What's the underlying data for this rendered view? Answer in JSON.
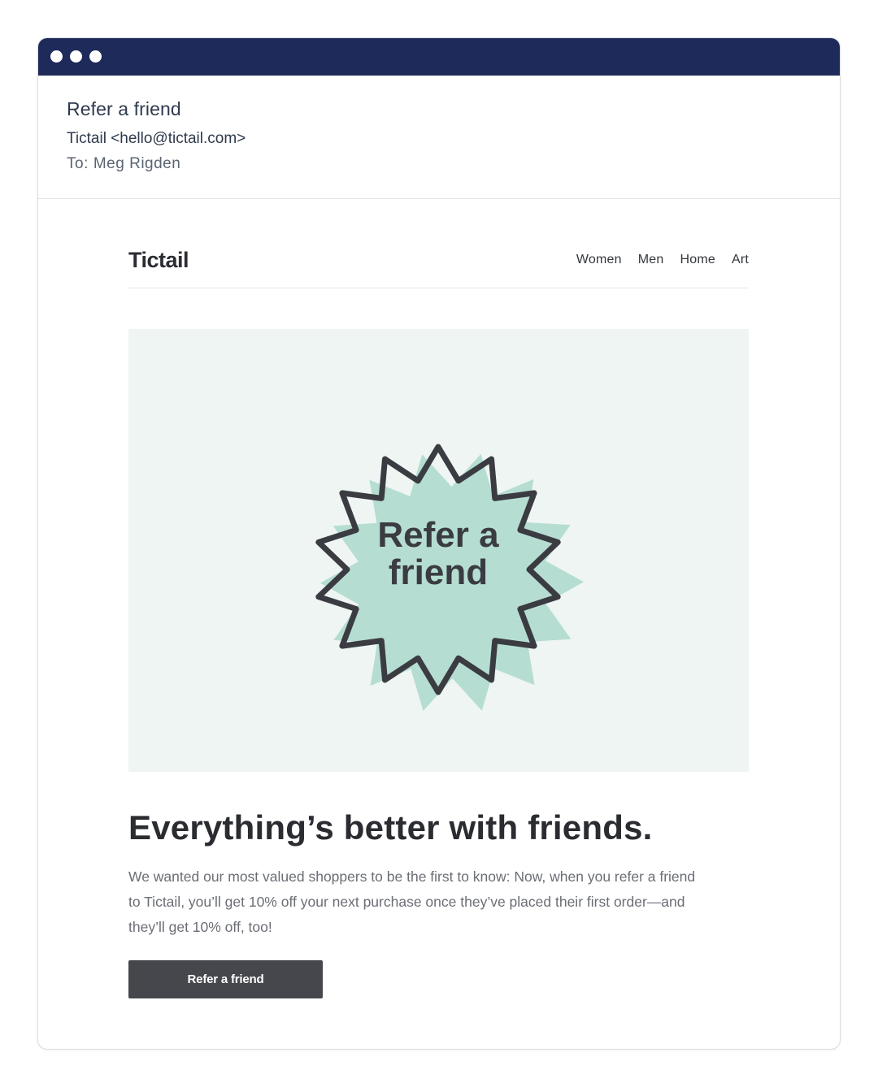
{
  "window": {
    "titlebar_color": "#1e2a5a",
    "dots": [
      "window-dot",
      "window-dot",
      "window-dot"
    ]
  },
  "email": {
    "subject": "Refer a friend",
    "sender": "Tictail <hello@tictail.com>",
    "to_label": "To:",
    "to_name": "Meg Rigden"
  },
  "newsletter": {
    "brand": "Tictail",
    "nav": [
      "Women",
      "Men",
      "Home",
      "Art"
    ],
    "hero": {
      "badge_line1": "Refer a",
      "badge_line2": "friend",
      "background_color": "#eef5f3",
      "accent_color": "#b6ddd1"
    },
    "headline": "Everything’s better with friends.",
    "body": "We wanted our most valued shoppers to be the first to know: Now, when you refer a friend to Tictail, you’ll get 10% off your next purchase once they’ve placed their first order—and they’ll get 10% off, too!",
    "cta_label": "Refer a friend"
  }
}
